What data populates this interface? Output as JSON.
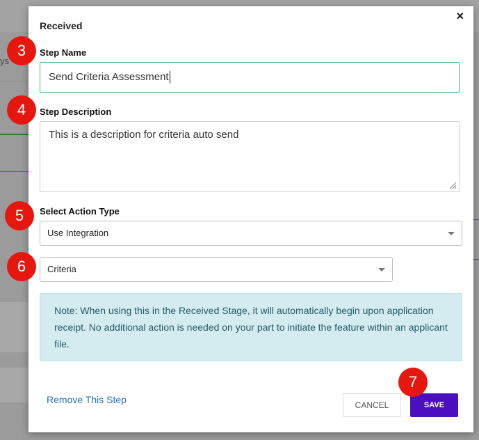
{
  "modal": {
    "title": "Received",
    "close_icon": "×",
    "step_name": {
      "label": "Step Name",
      "value": "Send Criteria Assessment"
    },
    "step_description": {
      "label": "Step Description",
      "value": "This is a description for criteria auto send"
    },
    "action_type": {
      "label": "Select Action Type",
      "selected": "Use Integration"
    },
    "integration": {
      "selected": "Criteria"
    },
    "note": "Note: When using this in the Received Stage, it will automatically begin upon application receipt. No additional action is needed on your part to initiate the feature within an applicant file.",
    "remove_link": "Remove This Step",
    "cancel_label": "CANCEL",
    "save_label": "SAVE"
  },
  "background": {
    "partial_text": "ys"
  },
  "badges": {
    "b3": "3",
    "b4": "4",
    "b5": "5",
    "b6": "6",
    "b7": "7"
  },
  "colors": {
    "accent": "#4b0fc0",
    "badge": "#e5170f",
    "input_focus": "#3fb26a",
    "note_bg": "#d4ecef"
  }
}
